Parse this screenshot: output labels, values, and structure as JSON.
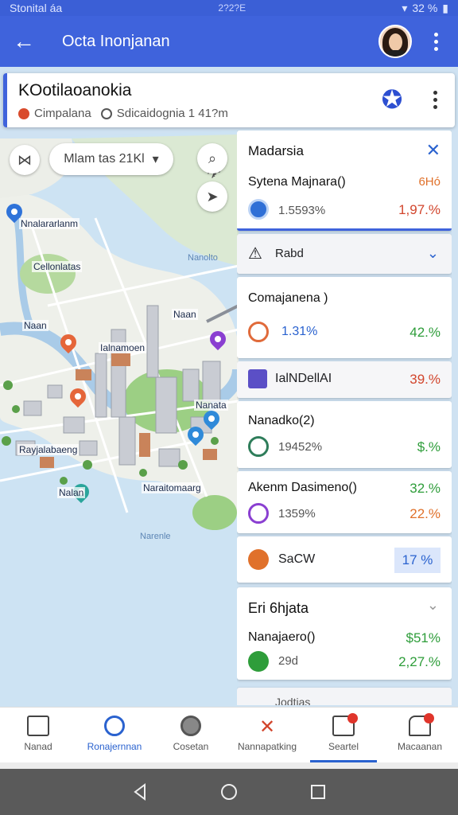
{
  "status_bar": {
    "left": "Stonital áa",
    "center": "2?2?E",
    "right": "32 %"
  },
  "app_bar": {
    "title": "Octa Inonjanan"
  },
  "place_card": {
    "title": "KOotilaoanokia",
    "chip1": "Cimpalana",
    "chip2": "Sdicaidognia 1 41?m"
  },
  "filter": {
    "label": "Mlam tas 21Kl"
  },
  "map_labels": {
    "l1": "Nnalararlanm",
    "l2": "Cellonlatas",
    "l3": "Naan",
    "l4": "Ialnamoen",
    "l5": "Naan",
    "l6": "Nanata",
    "l7": "Rayjalabaeng",
    "l8": "Nalan",
    "l9": "Naraitomaarg",
    "w1": "Nanolto",
    "w2": "Narenle"
  },
  "panel": {
    "header": {
      "title": "Madarsia",
      "name": "Sytena Majnara()",
      "name_val": "6Hó",
      "sub": "1.5593%",
      "sub_val": "1,97.%"
    },
    "sel": {
      "label": "Rabd"
    },
    "r1": {
      "title": "Comajanena )",
      "sub": "1.31%",
      "val": "42.%"
    },
    "r2": {
      "title": "IalNDellAI",
      "val": "39.%"
    },
    "r3": {
      "title": "Nanadko(2)",
      "sub": "19452%",
      "val": "$.%"
    },
    "r4": {
      "title": "Akenm Dasimeno()",
      "val1": "32.%",
      "sub": "1359%",
      "val2": "22.%"
    },
    "r5": {
      "title": "SaCW",
      "val": "17 %"
    },
    "r6": {
      "title": "Eri 6hjata",
      "name": "Nanajaero()",
      "val1": "$51%",
      "sub": "29d",
      "val2": "2,27.%"
    },
    "r7": {
      "title": "Jodtias"
    }
  },
  "bottom_nav": [
    {
      "label": "Nanad"
    },
    {
      "label": "Ronajernnan"
    },
    {
      "label": "Cosetan"
    },
    {
      "label": "Nannapatking"
    },
    {
      "label": "Seartel"
    },
    {
      "label": "Macaanan"
    }
  ],
  "colors": {
    "primary": "#3f63dc",
    "accent_green": "#2e9d3a",
    "accent_red": "#d2452c"
  }
}
